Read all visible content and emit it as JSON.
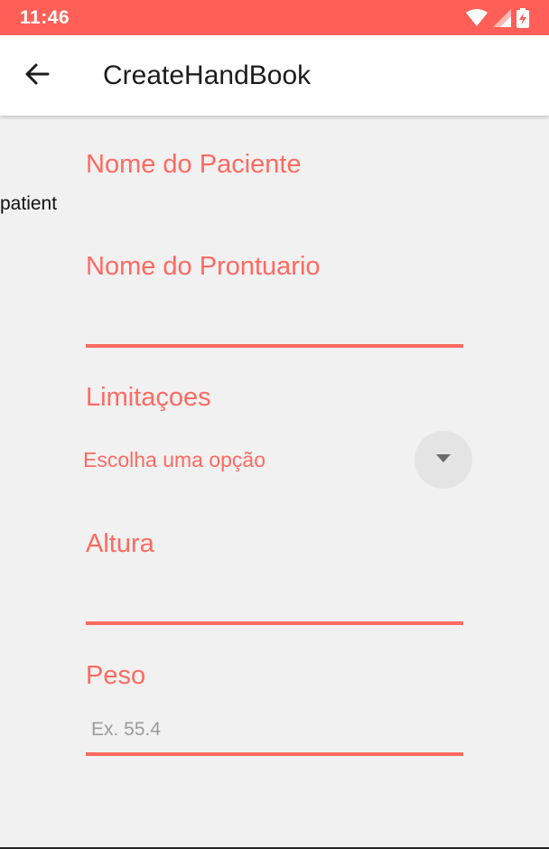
{
  "status_bar": {
    "time": "11:46",
    "icons": [
      "wifi-icon",
      "signal-icon",
      "battery-charging-icon"
    ],
    "color": "#ff5f57"
  },
  "appbar": {
    "back_icon": "arrow-left-icon",
    "title": "CreateHandBook"
  },
  "form": {
    "patient_name_label": "Nome do Paciente",
    "patient_name_value": "patient",
    "record_name_label": "Nome do Prontuario",
    "record_name_value": "",
    "limitations_label": "Limitaçoes",
    "limitations_selected": "Escolha uma opção",
    "height_label": "Altura",
    "height_value": "",
    "weight_label": "Peso",
    "weight_placeholder": "Ex. 55.4",
    "weight_value": ""
  },
  "colors": {
    "accent": "#ff6a61",
    "background": "#f1f1f1",
    "appbar_background": "#ffffff"
  }
}
